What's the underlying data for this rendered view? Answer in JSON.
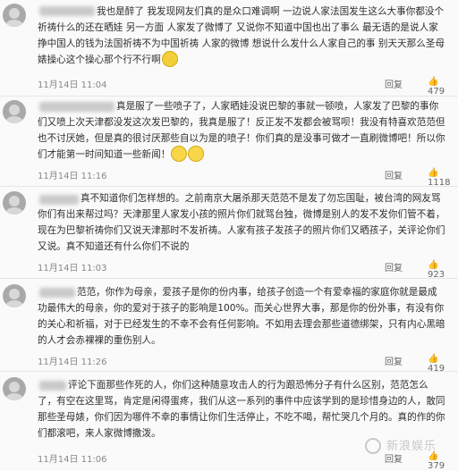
{
  "comments": [
    {
      "text": "我也是醉了 我发现网友们真的是众口难调啊 一边说人家法国发生这么大事你都没个祈祷什么的还在晒娃 另一方面 人家发了微博了 又说你不知道中国也出了事么 最无语的是说人家挣中国人的钱为法国祈祷不为中国祈祷 人家的微博 想说什么发什么人家自己的事 别天天那么圣母婊操心这个操心那个行不行啊",
      "time": "11月14日 11:04",
      "reply": "回复",
      "likes": "479"
    },
    {
      "text": "真是服了一些喷子了，人家晒娃没说巴黎的事就一顿喷，人家发了巴黎的事你们又喷上次天津都没发这次发巴黎的，我真是服了！反正发不发都会被骂呗！我没有特喜欢范范但也不讨厌她，但是真的很讨厌那些自以为是的喷子！你们真的是没事可做才一直刷微博吧！所以你们才能第一时间知道一些新闻！",
      "time": "11月14日 11:16",
      "reply": "回复",
      "likes": "1118"
    },
    {
      "text": "真不知道你们怎样想的。之前南京大屠杀那天范范不是发了勿忘国耻，被台湾的网友骂你们有出来帮过吗？天津那里人家发小孩的照片你们就骂台独，微博是别人的发不发你们管不着，现在为巴黎祈祷你们又说天津那时不发祈祷。人家有孩子发孩子的照片你们又晒孩子，关评论你们又说。真不知道还有什么你们不说的",
      "time": "11月14日 11:03",
      "reply": "回复",
      "likes": "923"
    },
    {
      "text": "范范，你作为母亲，爱孩子是你的份内事，给孩子创造一个有爱幸福的家庭你就是最成功最伟大的母亲，你的爱对于孩子的影响是100%。而关心世界大事，那是你的份外事，有没有你的关心和祈福，对于已经发生的不幸不会有任何影响。不如用去理会那些道德绑架，只有内心黑暗的人才会赤裸裸的重伤别人。",
      "time": "11月14日 11:26",
      "reply": "回复",
      "likes": "419"
    },
    {
      "text": "评论下面那些作死的人，你们这种随意攻击人的行为跟恐怖分子有什么区别，范范怎么了，有空在这里骂，肯定是闲得蛋疼，我们从这一系列的事件中应该学到的是珍惜身边的人，散同那些圣母婊，你们因为哪件不幸的事情让你们生活停止，不吃不喝，帮忙哭几个月的。真的作的你们都滚吧，来人家微博撒泼。",
      "time": "11月14日 11:06",
      "reply": "回复",
      "likes": "379"
    }
  ],
  "watermark": "新浪娱乐"
}
